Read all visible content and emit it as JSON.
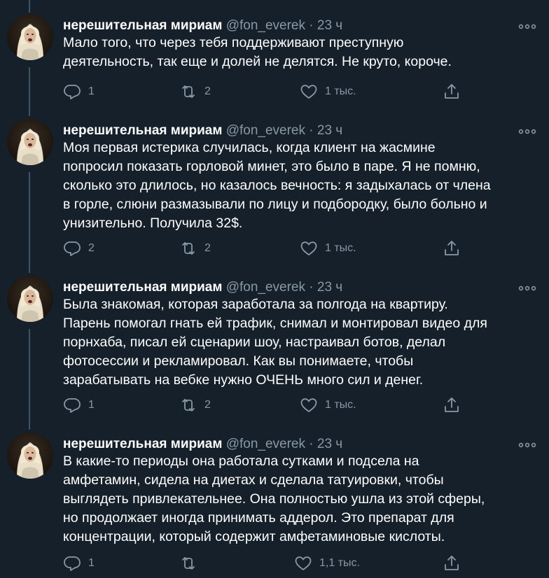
{
  "colors": {
    "background": "#15202b",
    "text": "#ffffff",
    "secondary": "#8899a6",
    "thread_line": "#3d5466"
  },
  "icons": {
    "more": "more-horizontal-icon",
    "reply": "reply-icon",
    "retweet": "retweet-icon",
    "like": "heart-icon",
    "share": "share-icon"
  },
  "tweets": [
    {
      "name": "нерешительная мириам",
      "handle": "@fon_everek",
      "separator": "·",
      "time": "23 ч",
      "text": "Мало того, что через тебя поддерживают преступную\nдеятельность, так еще и долей не делятся. Не круто, короче.",
      "replies": "1",
      "retweets": "2",
      "likes": "1 тыс."
    },
    {
      "name": "нерешительная мириам",
      "handle": "@fon_everek",
      "separator": "·",
      "time": "23 ч",
      "text": "Моя первая истерика случилась, когда клиент на жасмине\nпопросил показать горловой минет, это было в паре. Я не помню,\nсколько это длилось, но казалось вечность: я задыхалась от члена\nв горле, слюни размазывали по лицу и подбородку, было больно и\nунизительно. Получила 32$.",
      "replies": "2",
      "retweets": "2",
      "likes": "1 тыс."
    },
    {
      "name": "нерешительная мириам",
      "handle": "@fon_everek",
      "separator": "·",
      "time": "23 ч",
      "text": "Была знакомая, которая заработала за полгода на квартиру.\nПарень помогал гнать ей трафик, снимал и монтировал видео для\nпорнхаба, писал ей сценарии шоу, настраивал ботов, делал\nфотосессии и рекламировал. Как вы понимаете, чтобы\nзарабатывать на вебке нужно ОЧЕНЬ много сил и денег.",
      "replies": "1",
      "retweets": "2",
      "likes": "1 тыс."
    },
    {
      "name": "нерешительная мириам",
      "handle": "@fon_everek",
      "separator": "·",
      "time": "23 ч",
      "text": "В какие-то периоды она работала сутками и подсела на\nамфетамин, сидела на диетах и сделала татуировки, чтобы\nвыглядеть привлекательнее. Она полностью ушла из этой сферы,\nно продолжает иногда принимать аддерол. Это препарат для\nконцентрации, который содержит амфетаминовые кислоты.",
      "replies": "1",
      "retweets": "",
      "likes": "1,1 тыс."
    }
  ]
}
